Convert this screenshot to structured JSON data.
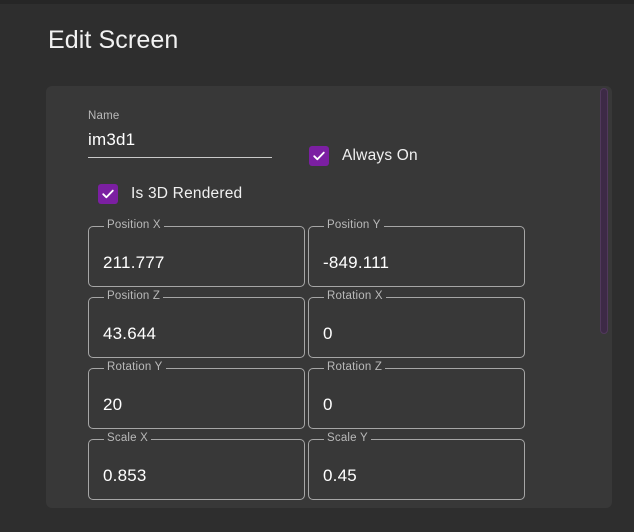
{
  "page": {
    "title": "Edit Screen",
    "background_color": "#2e2e2e",
    "panel_color": "#383838",
    "accent_color": "#7b1fa2"
  },
  "form": {
    "name_field": {
      "label": "Name",
      "value": "im3d1",
      "placeholder": "Name"
    },
    "checkboxes": [
      {
        "label": "Always On",
        "checked": true
      },
      {
        "label": "Is 3D Rendered",
        "checked": true
      }
    ],
    "transform_fields": [
      {
        "label": "Position X",
        "value": "211.777"
      },
      {
        "label": "Position Y",
        "value": "-849.111"
      },
      {
        "label": "Position Z",
        "value": "43.644"
      },
      {
        "label": "Rotation X",
        "value": "0"
      },
      {
        "label": "Rotation Y",
        "value": "20"
      },
      {
        "label": "Rotation Z",
        "value": "0"
      },
      {
        "label": "Scale X",
        "value": "0.853"
      },
      {
        "label": "Scale Y",
        "value": "0.45"
      }
    ]
  },
  "scrollbar": {
    "orientation": "vertical",
    "thumb_color": "#3d2a46"
  }
}
